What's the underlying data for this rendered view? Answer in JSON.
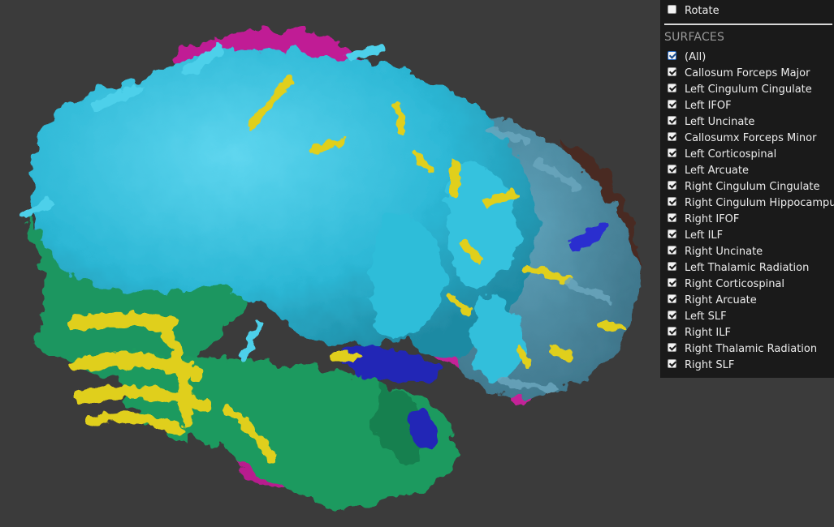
{
  "controls": {
    "rotate_label": "Rotate",
    "rotate_checked": false
  },
  "surfaces": {
    "header": "SURFACES",
    "items": [
      {
        "label": "(All)",
        "checked": true
      },
      {
        "label": "Callosum Forceps Major",
        "checked": true
      },
      {
        "label": "Left Cingulum Cingulate",
        "checked": true
      },
      {
        "label": "Left IFOF",
        "checked": true
      },
      {
        "label": "Left Uncinate",
        "checked": true
      },
      {
        "label": "Callosumx Forceps Minor",
        "checked": true
      },
      {
        "label": "Left Corticospinal",
        "checked": true
      },
      {
        "label": "Left Arcuate",
        "checked": true
      },
      {
        "label": "Right Cingulum Cingulate",
        "checked": true
      },
      {
        "label": "Right Cingulum Hippocampus",
        "checked": true
      },
      {
        "label": "Right IFOF",
        "checked": true
      },
      {
        "label": "Left ILF",
        "checked": true
      },
      {
        "label": "Right Uncinate",
        "checked": true
      },
      {
        "label": "Left Thalamic Radiation",
        "checked": true
      },
      {
        "label": "Right Corticospinal",
        "checked": true
      },
      {
        "label": "Right Arcuate",
        "checked": true
      },
      {
        "label": "Left SLF",
        "checked": true
      },
      {
        "label": "Right ILF",
        "checked": true
      },
      {
        "label": "Right Thalamic Radiation",
        "checked": true
      },
      {
        "label": "Right SLF",
        "checked": true
      }
    ]
  },
  "colors": {
    "background": "#3b3b3b",
    "panel": "#1a1a1a",
    "cyan": "#2ec3e0",
    "yellow": "#e3d21c",
    "green": "#1f9a5f",
    "magenta": "#c81e9a",
    "blue": "#2326b8",
    "slate": "#4f8ea6",
    "brown": "#4a2a22"
  }
}
